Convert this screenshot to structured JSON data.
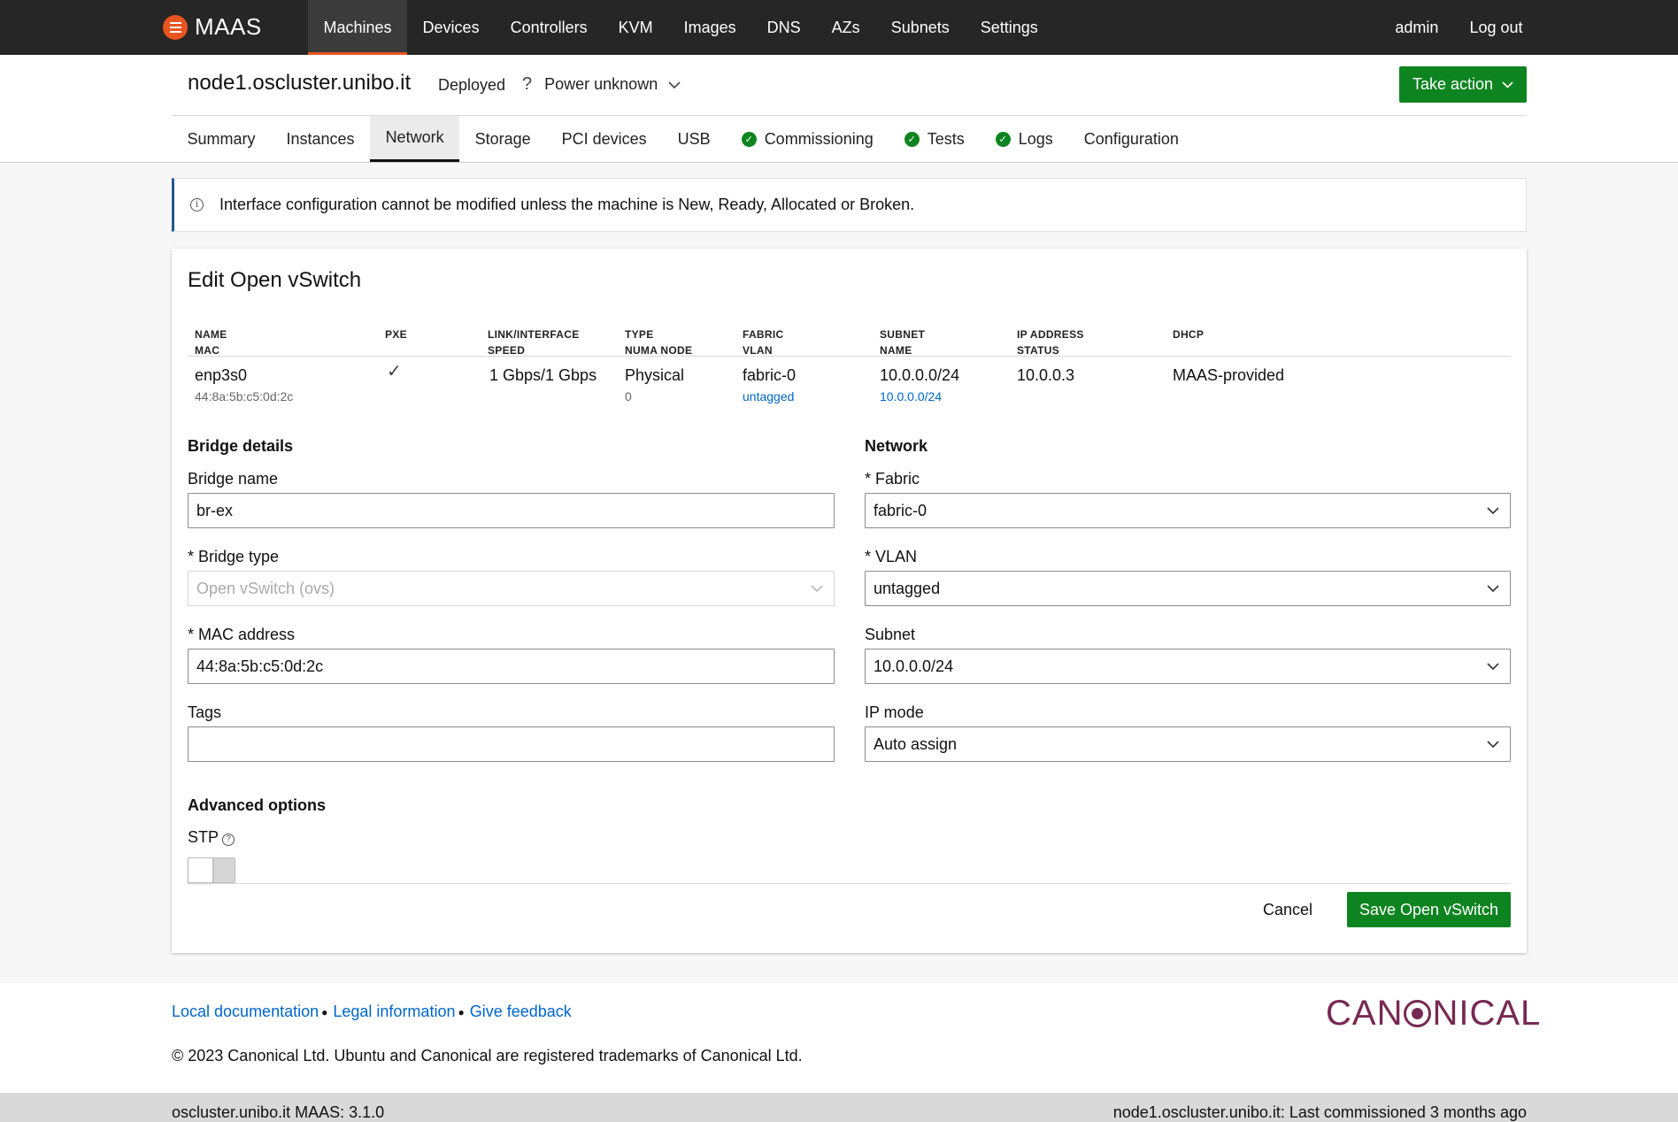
{
  "nav": {
    "brand": "MAAS",
    "links": [
      "Machines",
      "Devices",
      "Controllers",
      "KVM",
      "Images",
      "DNS",
      "AZs",
      "Subnets",
      "Settings"
    ],
    "user": "admin",
    "logout": "Log out"
  },
  "header": {
    "hostname": "node1.oscluster.unibo.it",
    "status": "Deployed",
    "power_icon": "?",
    "power": "Power unknown",
    "take_action": "Take action"
  },
  "tabs": [
    {
      "label": "Summary",
      "check": false
    },
    {
      "label": "Instances",
      "check": false
    },
    {
      "label": "Network",
      "check": false,
      "active": true
    },
    {
      "label": "Storage",
      "check": false
    },
    {
      "label": "PCI devices",
      "check": false
    },
    {
      "label": "USB",
      "check": false
    },
    {
      "label": "Commissioning",
      "check": true
    },
    {
      "label": "Tests",
      "check": true
    },
    {
      "label": "Logs",
      "check": true
    },
    {
      "label": "Configuration",
      "check": false
    }
  ],
  "notice": "Interface configuration cannot be modified unless the machine is New, Ready, Allocated or Broken.",
  "form": {
    "title": "Edit Open vSwitch",
    "table": {
      "headers": {
        "name": [
          "NAME",
          "MAC"
        ],
        "pxe": [
          "PXE"
        ],
        "link": [
          "LINK/INTERFACE",
          "SPEED"
        ],
        "type": [
          "TYPE",
          "NUMA NODE"
        ],
        "fabric": [
          "FABRIC",
          "VLAN"
        ],
        "subnet": [
          "SUBNET",
          "NAME"
        ],
        "ip": [
          "IP ADDRESS",
          "STATUS"
        ],
        "dhcp": [
          "DHCP"
        ]
      },
      "row": {
        "name": "enp3s0",
        "mac": "44:8a:5b:c5:0d:2c",
        "pxe": "✓",
        "link": "1 Gbps/1 Gbps",
        "type": "Physical",
        "numa": "0",
        "fabric": "fabric-0",
        "vlan": "untagged",
        "subnet": "10.0.0.0/24",
        "subnet_name": "10.0.0.0/24",
        "ip": "10.0.0.3",
        "dhcp": "MAAS-provided"
      }
    },
    "bridge": {
      "title": "Bridge details",
      "name_label": "Bridge name",
      "name_value": "br-ex",
      "type_label": "* Bridge type",
      "type_value": "Open vSwitch (ovs)",
      "mac_label": "* MAC address",
      "mac_value": "44:8a:5b:c5:0d:2c",
      "tags_label": "Tags",
      "tags_value": ""
    },
    "network": {
      "title": "Network",
      "fabric_label": "* Fabric",
      "fabric_value": "fabric-0",
      "vlan_label": "* VLAN",
      "vlan_value": "untagged",
      "subnet_label": "Subnet",
      "subnet_value": "10.0.0.0/24",
      "ipmode_label": "IP mode",
      "ipmode_value": "Auto assign"
    },
    "advanced": {
      "title": "Advanced options",
      "stp_label": "STP",
      "stp_enabled": false
    },
    "cancel": "Cancel",
    "save": "Save Open vSwitch"
  },
  "footer": {
    "links": [
      "Local documentation",
      "Legal information",
      "Give feedback"
    ],
    "copyright": "© 2023 Canonical Ltd. Ubuntu and Canonical are registered trademarks of Canonical Ltd.",
    "logo_text": "CANONICAL"
  },
  "statusbar": {
    "left_host": "oscluster.unibo.it",
    "left_version": "MAAS: 3.1.0",
    "right_host": "node1.oscluster.unibo.it:",
    "right_status": "Last commissioned 3 months ago"
  },
  "colors": {
    "nav_bg": "#262626",
    "accent_orange": "#e95420",
    "positive_green": "#0e8420",
    "link_blue": "#0066cc",
    "canonical_aubergine": "#772953",
    "info_border": "#24598f"
  }
}
